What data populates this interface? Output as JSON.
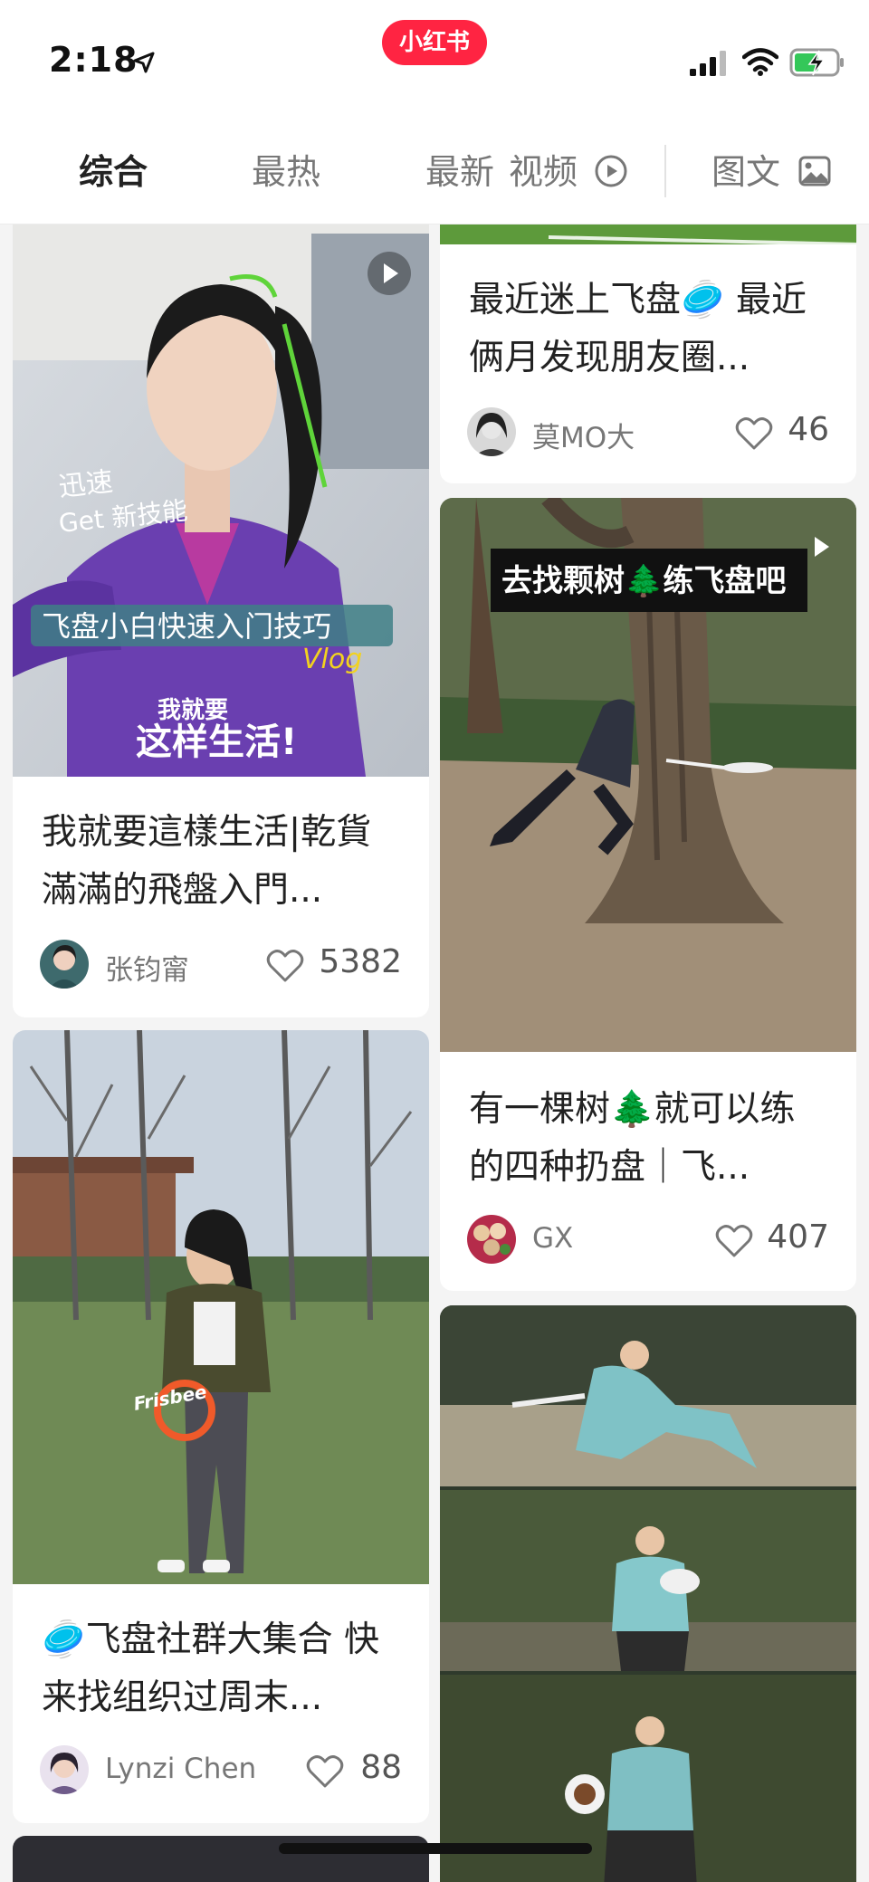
{
  "status_bar": {
    "time": "2:18",
    "app_badge": "小红书",
    "icons": [
      "location-arrow-icon",
      "cellular-signal-icon",
      "wifi-icon",
      "battery-charging-icon"
    ]
  },
  "tabs": {
    "zonghe": "综合",
    "zuire": "最热",
    "zuixin": "最新",
    "video": "视频",
    "tuwen": "图文"
  },
  "cards": [
    {
      "title": "我就要這樣生活|乾貨滿滿的飛盤入門...",
      "author": "张钧甯",
      "likes": "5382",
      "overlay": {
        "text1": "迅速",
        "text2": "Get 新技能",
        "text3": "飞盘小白快速入门技巧",
        "text4": "Vlog",
        "text5": "我就要",
        "text6": "这样生活!"
      }
    },
    {
      "title": "🥏飞盘社群大集合 快来找组织过周末...",
      "author": "Lynzi Chen",
      "likes": "88",
      "overlay": {
        "text1": "Frisbee"
      }
    },
    {
      "title": "最近迷上飞盘🥏 最近俩月发现朋友圈...",
      "author": "莫MO大",
      "likes": "46"
    },
    {
      "title": "有一棵树🌲就可以练的四种扔盘｜飞...",
      "author": "GX",
      "likes": "407",
      "overlay": {
        "text1": "去找颗树🌲练飞盘吧"
      }
    }
  ],
  "colors": {
    "brand": "#ff2442",
    "background": "#f4f4f4",
    "card": "#ffffff",
    "battery_green": "#34c759"
  }
}
